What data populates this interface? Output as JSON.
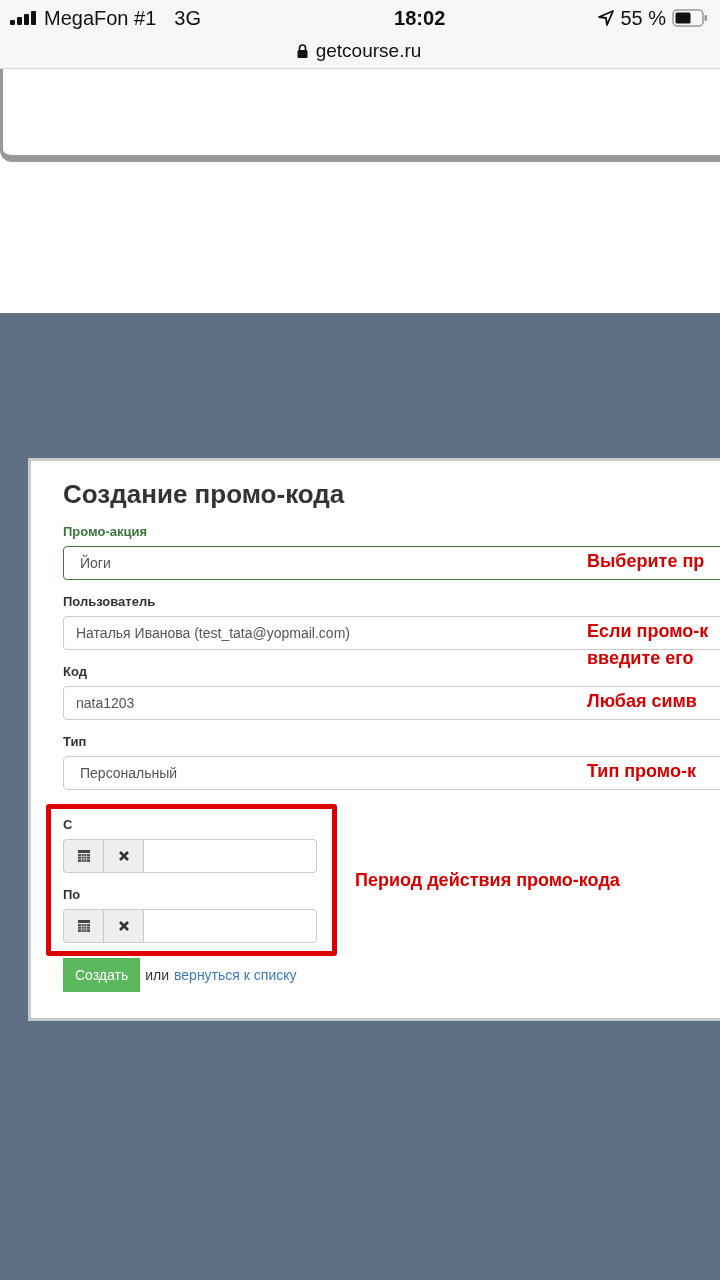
{
  "status_bar": {
    "carrier": "MegaFon #1",
    "network": "3G",
    "time": "18:02",
    "battery": "55 %"
  },
  "address_bar": {
    "url": "getcourse.ru"
  },
  "form": {
    "title": "Создание промо-кода",
    "fields": [
      {
        "label": "Промо-акция",
        "value": "Йоги",
        "kind": "select",
        "valid": true,
        "note": [
          "Выберите пр"
        ]
      },
      {
        "label": "Пользователь",
        "value": "Наталья Иванова (test_tata@yopmail.com)",
        "kind": "text",
        "valid": false,
        "note": [
          "Если промо-к",
          "введите его"
        ]
      },
      {
        "label": "Код",
        "value": "nata1203",
        "kind": "text",
        "valid": false,
        "note": [
          "Любая симв"
        ]
      },
      {
        "label": "Тип",
        "value": "Персональный",
        "kind": "select",
        "valid": false,
        "note": [
          "Тип промо-к"
        ]
      }
    ],
    "dates": [
      {
        "label": "С"
      },
      {
        "label": "По"
      }
    ],
    "dates_note": "Период действия промо-кода",
    "submit": "Создать",
    "or_text": "или",
    "back_link": "вернуться к списку"
  }
}
